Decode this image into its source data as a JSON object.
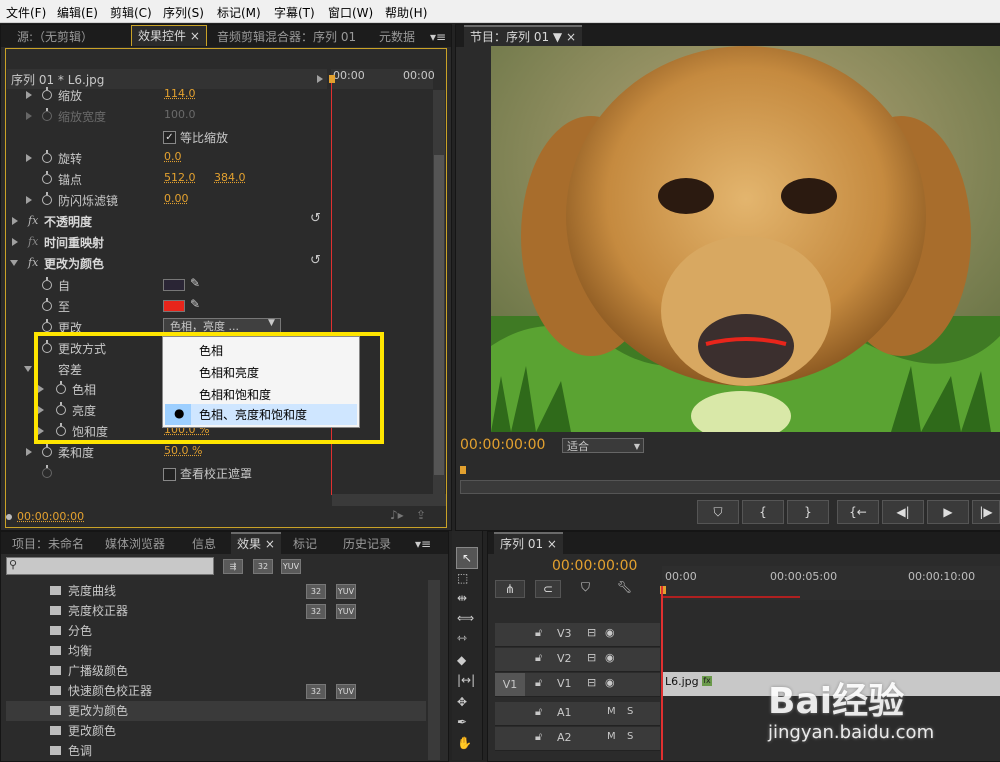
{
  "menu": [
    "文件(F)",
    "编辑(E)",
    "剪辑(C)",
    "序列(S)",
    "标记(M)",
    "字幕(T)",
    "窗口(W)",
    "帮助(H)"
  ],
  "top_left_panel": {
    "tabs": [
      "源:（无剪辑）",
      "效果控件",
      "音频剪辑混合器：序列 01",
      "元数据"
    ],
    "clip_title": "序列 01 * L6.jpg",
    "ruler": [
      "00:00",
      "00:00"
    ],
    "props": {
      "scale": {
        "label": "缩放",
        "value": "114.0"
      },
      "scale_width": {
        "label": "缩放宽度",
        "value": "100.0"
      },
      "uniform_scale": "等比缩放",
      "rotation": {
        "label": "旋转",
        "value": "0.0"
      },
      "anchor": {
        "label": "锚点",
        "x": "512.0",
        "y": "384.0"
      },
      "antiflicker": {
        "label": "防闪烁滤镜",
        "value": "0.00"
      },
      "opacity": "不透明度",
      "time_remap": "时间重映射",
      "change_to_color": "更改为颜色",
      "from": "自",
      "to": "至",
      "change": "更改",
      "change_value": "色相，亮度 ...",
      "change_by": "更改方式",
      "tolerance": "容差",
      "hue": "色相",
      "lightness": "亮度",
      "saturation": {
        "label": "饱和度",
        "value": "100.0 %"
      },
      "softness": {
        "label": "柔和度",
        "value": "50.0 %"
      },
      "view_mask": "查看校正遮罩"
    },
    "dropdown_options": [
      "色相",
      "色相和亮度",
      "色相和饱和度",
      "色相、亮度和饱和度"
    ],
    "timecode": "00:00:00:00"
  },
  "program": {
    "tab": "节目：序列 01",
    "timecode": "00:00:00:00",
    "fit": "适合"
  },
  "project_panel": {
    "tabs": [
      "项目：未命名",
      "媒体浏览器",
      "信息",
      "效果",
      "标记",
      "历史记录"
    ],
    "badges": [
      "32",
      "YUV"
    ],
    "effects": [
      {
        "name": "亮度曲线",
        "b32": "32",
        "yuv": "YUV"
      },
      {
        "name": "亮度校正器",
        "b32": "32",
        "yuv": "YUV"
      },
      {
        "name": "分色",
        "b32": "",
        "yuv": ""
      },
      {
        "name": "均衡",
        "b32": "",
        "yuv": ""
      },
      {
        "name": "广播级颜色",
        "b32": "",
        "yuv": ""
      },
      {
        "name": "快速颜色校正器",
        "b32": "32",
        "yuv": "YUV"
      },
      {
        "name": "更改为颜色",
        "b32": "",
        "yuv": ""
      },
      {
        "name": "更改颜色",
        "b32": "",
        "yuv": ""
      },
      {
        "name": "色调",
        "b32": "",
        "yuv": ""
      }
    ]
  },
  "timeline": {
    "tab": "序列 01",
    "timecode": "00:00:00:00",
    "ruler": [
      "00:00",
      "00:00:05:00",
      "00:00:10:00"
    ],
    "tracks": [
      {
        "name": "V3",
        "src": "",
        "a": "",
        "b": ""
      },
      {
        "name": "V2",
        "src": "",
        "a": "",
        "b": ""
      },
      {
        "name": "V1",
        "src": "V1",
        "a": "",
        "b": ""
      },
      {
        "name": "A1",
        "src": "",
        "a": "M",
        "b": "S"
      },
      {
        "name": "A2",
        "src": "",
        "a": "M",
        "b": "S"
      }
    ],
    "clip": "L6.jpg"
  },
  "watermark": {
    "brand": "Bai经验",
    "url": "jingyan.baidu.com"
  },
  "colors": {
    "accent": "#e3a12f",
    "highlight": "#ffe500",
    "playhead": "#e03030",
    "to_swatch": "#e8251b",
    "from_swatch": "#2a2535"
  }
}
